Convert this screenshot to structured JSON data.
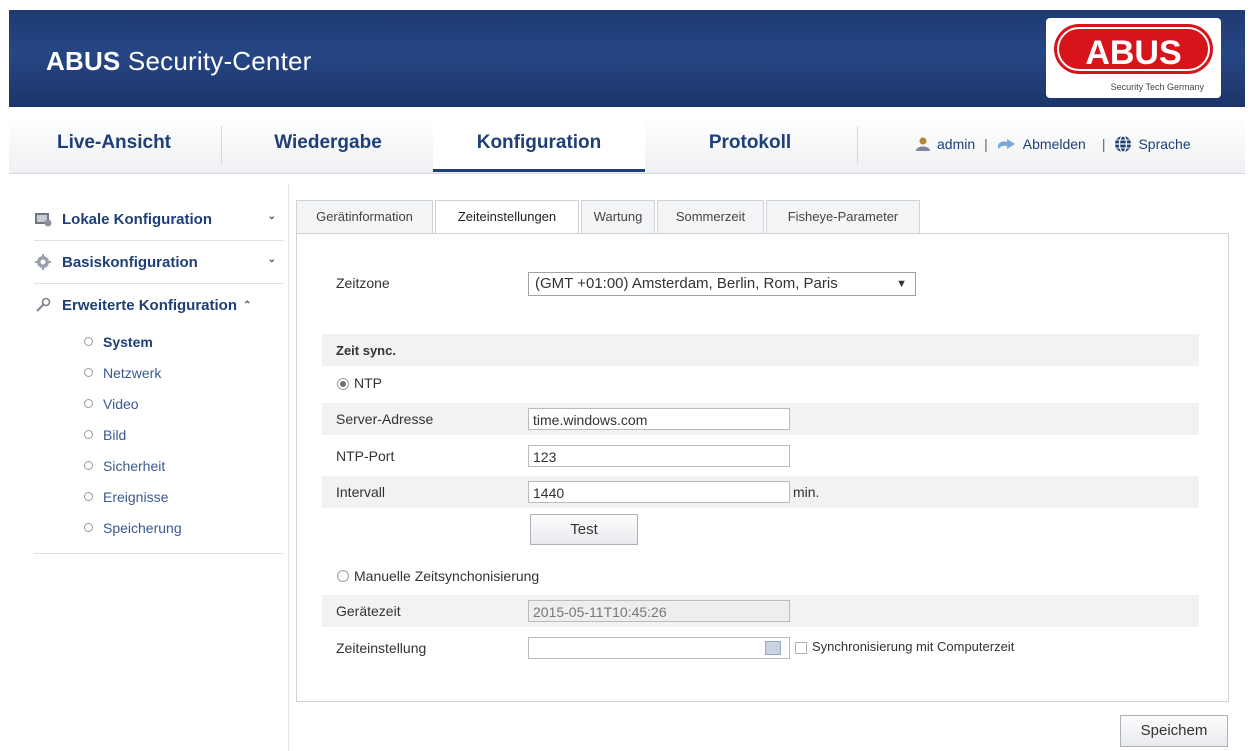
{
  "header": {
    "brand_bold": "ABUS",
    "brand_rest": "Security-Center",
    "logo_text": "ABUS",
    "logo_tagline": "Security Tech Germany"
  },
  "nav": {
    "tabs": [
      {
        "label": "Live-Ansicht"
      },
      {
        "label": "Wiedergabe"
      },
      {
        "label": "Konfiguration",
        "active": true
      },
      {
        "label": "Protokoll"
      }
    ],
    "user": "admin",
    "logout": "Abmelden",
    "language": "Sprache"
  },
  "sidebar": {
    "groups": [
      {
        "label": "Lokale Konfiguration",
        "icon": "local-config-icon",
        "chevron": "v"
      },
      {
        "label": "Basiskonfiguration",
        "icon": "gear-icon",
        "chevron": "v"
      },
      {
        "label": "Erweiterte Konfiguration",
        "icon": "wrench-icon",
        "chevron": "^"
      }
    ],
    "subitems": [
      "System",
      "Netzwerk",
      "Video",
      "Bild",
      "Sicherheit",
      "Ereignisse",
      "Speicherung"
    ],
    "active_subitem": "System"
  },
  "tabs": {
    "items": [
      "Gerätinformation",
      "Zeiteinstellungen",
      "Wartung",
      "Sommerzeit",
      "Fisheye-Parameter"
    ],
    "active": "Zeiteinstellungen"
  },
  "form": {
    "timezone_label": "Zeitzone",
    "timezone_value": "(GMT +01:00) Amsterdam, Berlin, Rom, Paris",
    "sync_section": "Zeit sync.",
    "ntp_label": "NTP",
    "ntp_checked": true,
    "server_label": "Server-Adresse",
    "server_value": "time.windows.com",
    "port_label": "NTP-Port",
    "port_value": "123",
    "interval_label": "Intervall",
    "interval_value": "1440",
    "interval_unit": "min.",
    "test_button": "Test",
    "manual_label": "Manuelle Zeitsynchonisierung",
    "manual_checked": false,
    "device_time_label": "Gerätezeit",
    "device_time_value": "2015-05-11T10:45:26",
    "time_setting_label": "Zeiteinstellung",
    "time_setting_value": "",
    "sync_pc_label": "Synchronisierung mit Computerzeit",
    "sync_pc_checked": false,
    "save_button": "Speichem"
  },
  "colors": {
    "header_bg": "#274685",
    "brand_text": "#1e3f78",
    "logo_red": "#d8141b"
  }
}
